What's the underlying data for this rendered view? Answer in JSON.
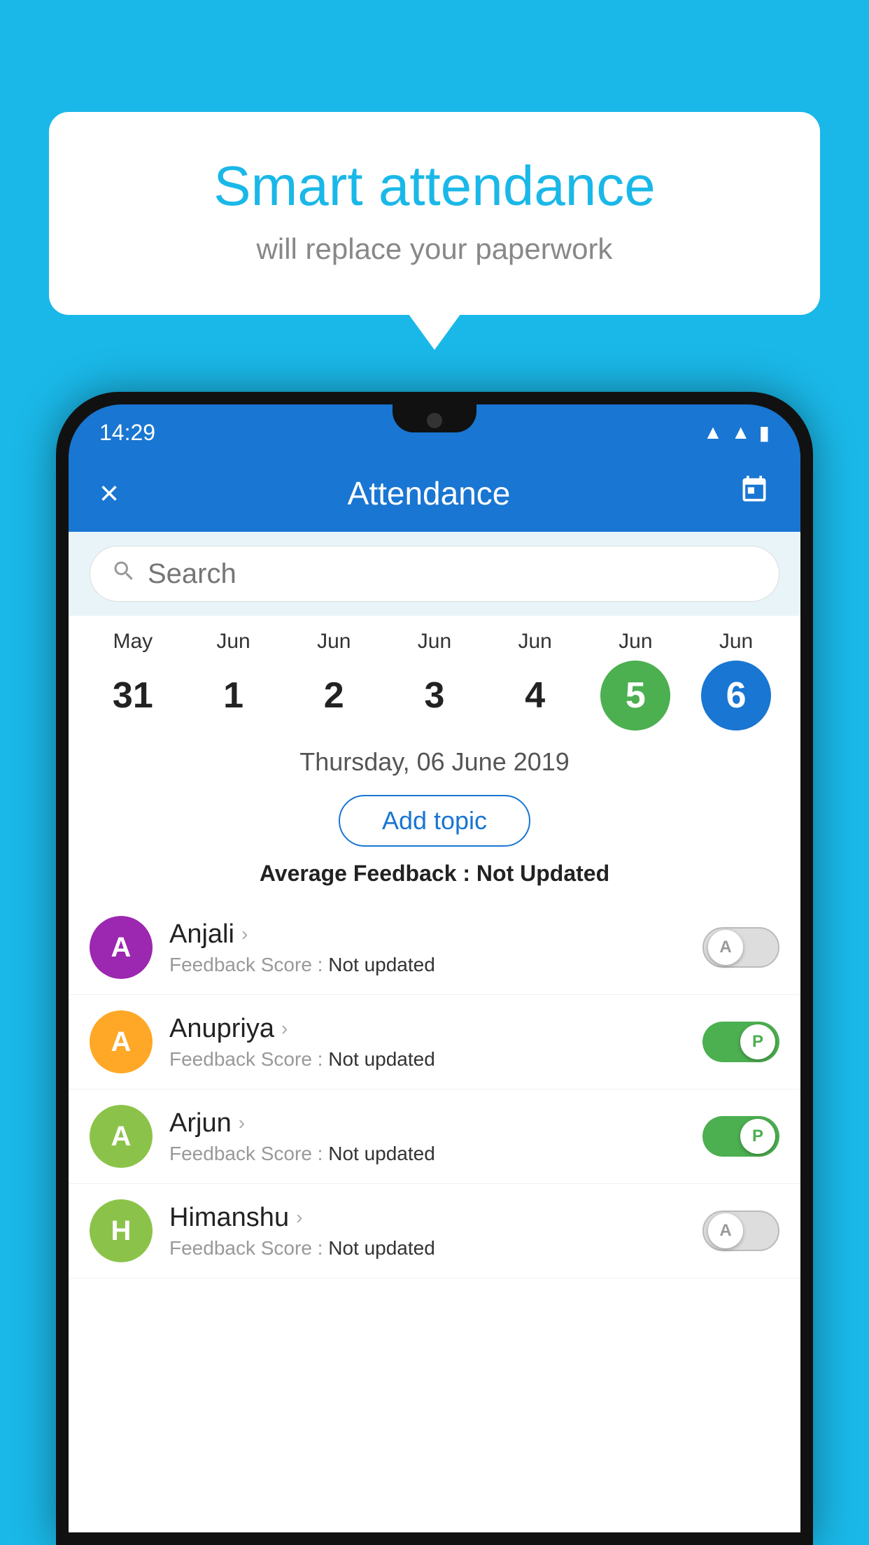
{
  "background_color": "#1ab8e8",
  "bubble": {
    "title": "Smart attendance",
    "subtitle": "will replace your paperwork"
  },
  "status_bar": {
    "time": "14:29",
    "icons": [
      "wifi",
      "signal",
      "battery"
    ]
  },
  "header": {
    "title": "Attendance",
    "close_label": "×",
    "calendar_icon": "📅"
  },
  "search": {
    "placeholder": "Search"
  },
  "calendar": {
    "days": [
      {
        "month": "May",
        "date": "31",
        "state": "normal"
      },
      {
        "month": "Jun",
        "date": "1",
        "state": "normal"
      },
      {
        "month": "Jun",
        "date": "2",
        "state": "normal"
      },
      {
        "month": "Jun",
        "date": "3",
        "state": "normal"
      },
      {
        "month": "Jun",
        "date": "4",
        "state": "normal"
      },
      {
        "month": "Jun",
        "date": "5",
        "state": "today"
      },
      {
        "month": "Jun",
        "date": "6",
        "state": "selected"
      }
    ]
  },
  "date_display": "Thursday, 06 June 2019",
  "add_topic_label": "Add topic",
  "avg_feedback": {
    "label": "Average Feedback :",
    "value": "Not Updated"
  },
  "students": [
    {
      "name": "Anjali",
      "feedback_label": "Feedback Score :",
      "feedback_value": "Not updated",
      "avatar_letter": "A",
      "avatar_color": "#9c27b0",
      "toggle_state": "off",
      "toggle_letter": "A"
    },
    {
      "name": "Anupriya",
      "feedback_label": "Feedback Score :",
      "feedback_value": "Not updated",
      "avatar_letter": "A",
      "avatar_color": "#ffa726",
      "toggle_state": "on",
      "toggle_letter": "P"
    },
    {
      "name": "Arjun",
      "feedback_label": "Feedback Score :",
      "feedback_value": "Not updated",
      "avatar_letter": "A",
      "avatar_color": "#8bc34a",
      "toggle_state": "on",
      "toggle_letter": "P"
    },
    {
      "name": "Himanshu",
      "feedback_label": "Feedback Score :",
      "feedback_value": "Not updated",
      "avatar_letter": "H",
      "avatar_color": "#8bc34a",
      "toggle_state": "off",
      "toggle_letter": "A"
    }
  ]
}
